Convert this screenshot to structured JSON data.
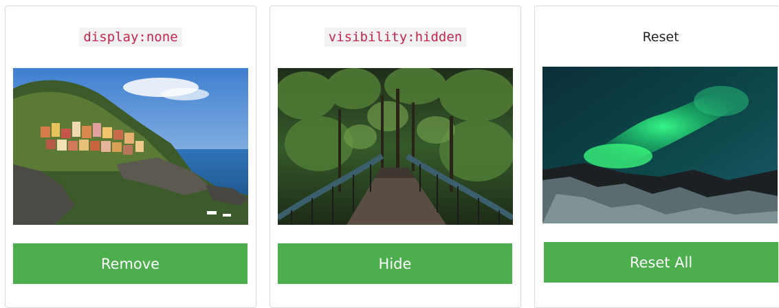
{
  "cards": [
    {
      "title": "display:none",
      "title_style": "code",
      "image_subject": "cliffside coastal village",
      "button_label": "Remove"
    },
    {
      "title": "visibility:hidden",
      "title_style": "code",
      "image_subject": "forest footbridge",
      "button_label": "Hide"
    },
    {
      "title": "Reset",
      "title_style": "plain",
      "image_subject": "northern lights over mountains",
      "button_label": "Reset All"
    }
  ],
  "colors": {
    "button_bg": "#4cae4c",
    "button_text": "#ffffff",
    "code_text": "#c7254e",
    "code_bg": "#f2f2f2"
  }
}
